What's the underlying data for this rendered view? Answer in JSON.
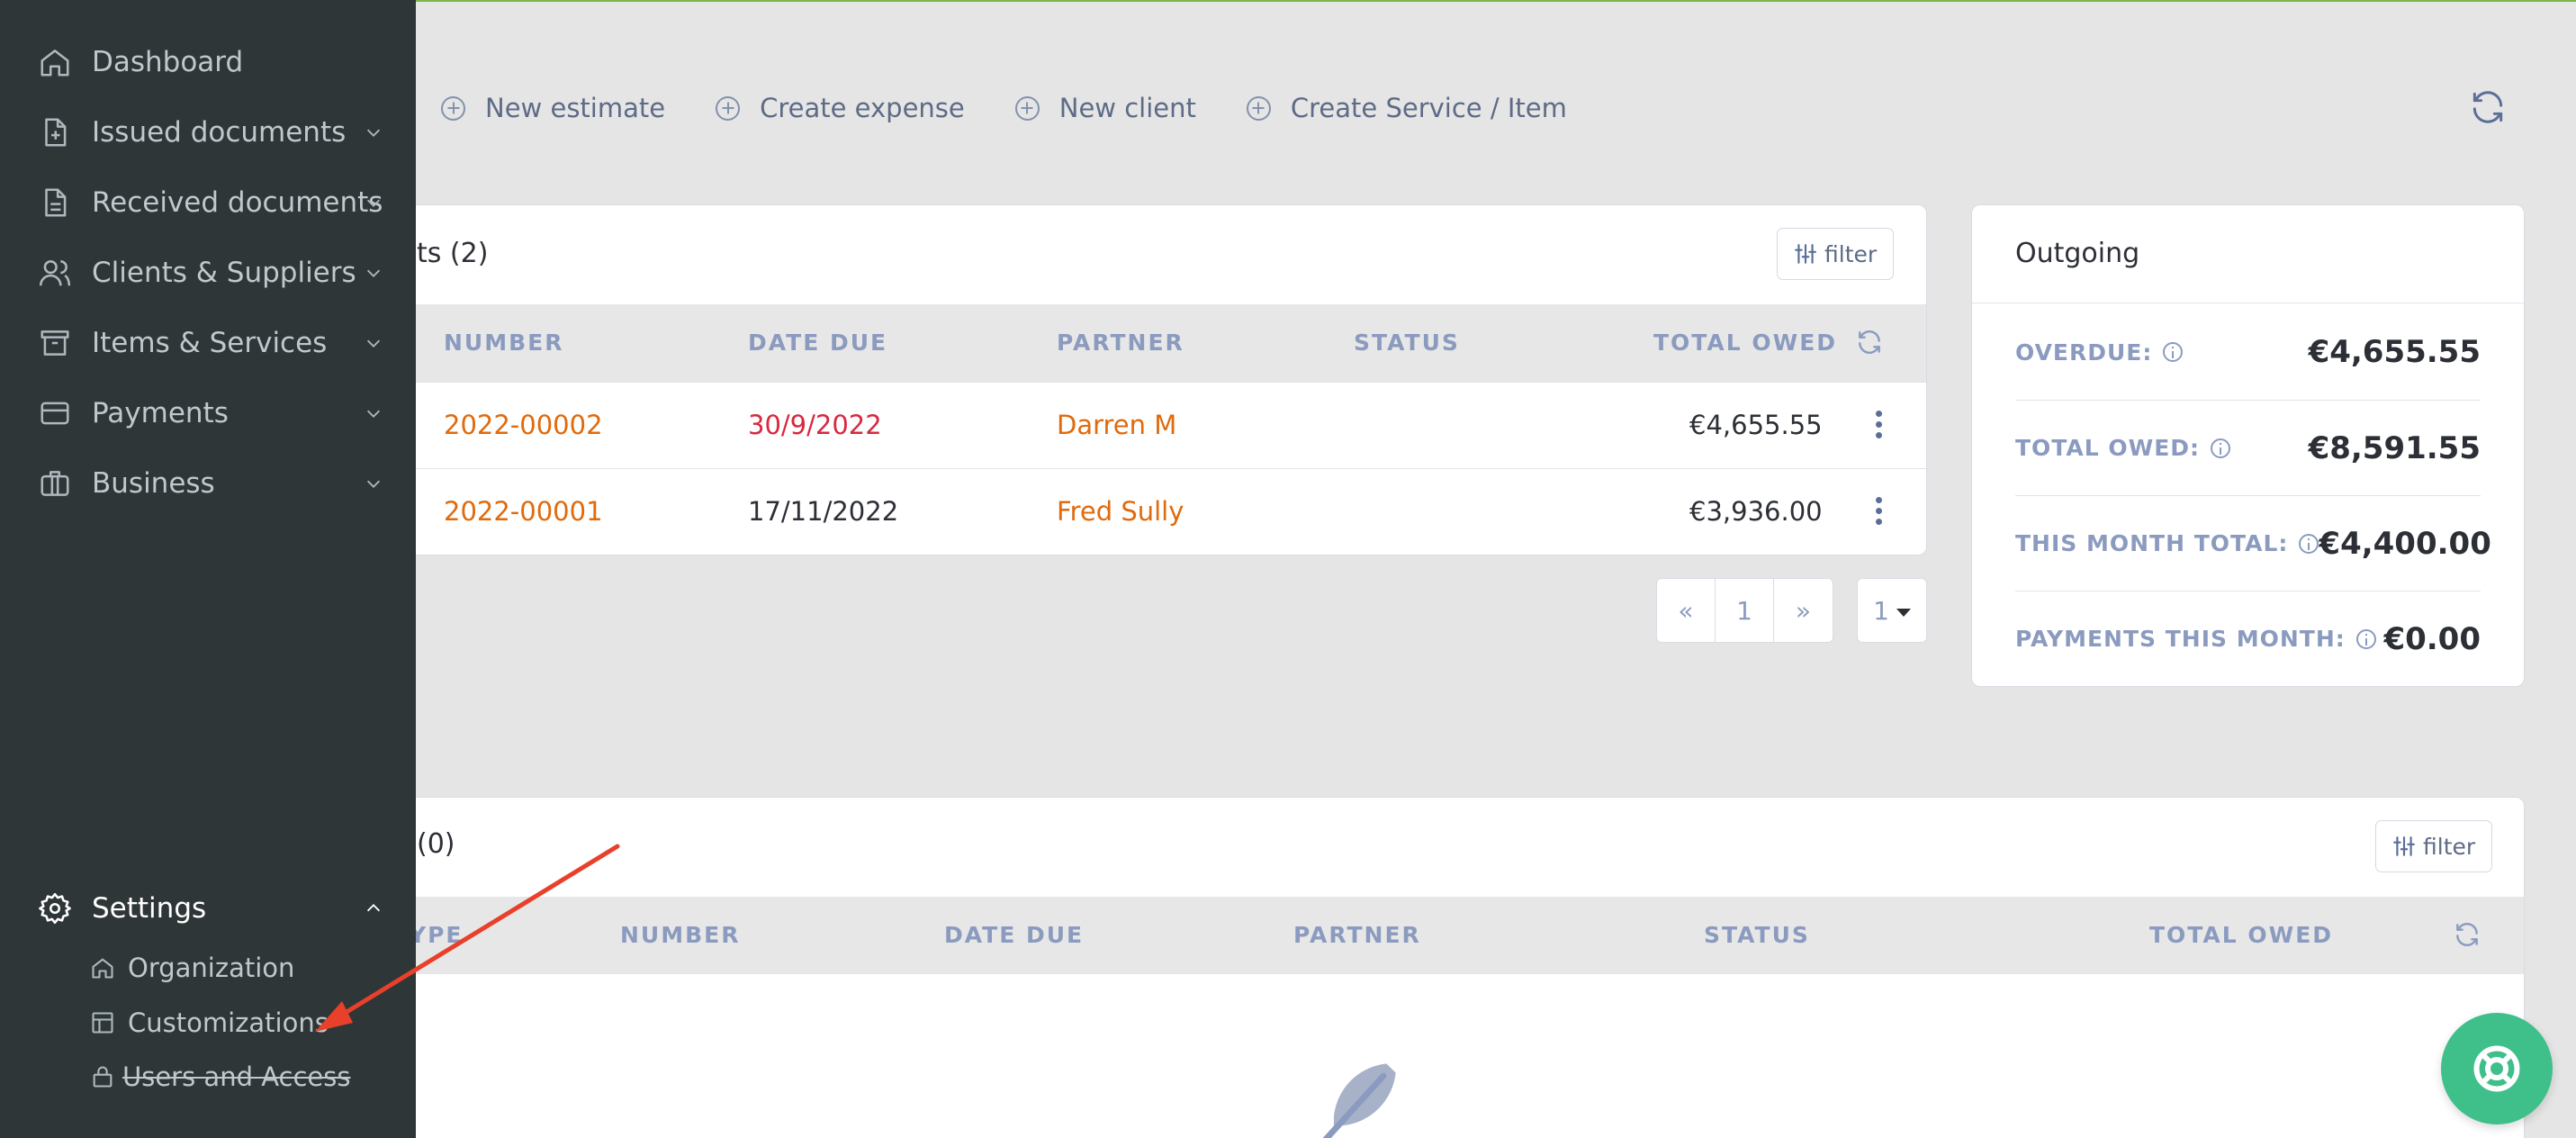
{
  "actions": [
    {
      "label": "New estimate",
      "icon": "plus-circle-icon"
    },
    {
      "label": "Create expense",
      "icon": "plus-circle-icon"
    },
    {
      "label": "New client",
      "icon": "plus-circle-icon"
    },
    {
      "label": "Create Service / Item",
      "icon": "plus-circle-icon"
    }
  ],
  "estimates": {
    "title": "ts (2)",
    "filter_label": "filter",
    "columns": [
      "NUMBER",
      "DATE DUE",
      "PARTNER",
      "STATUS",
      "TOTAL OWED"
    ],
    "rows": [
      {
        "number": "2022-00002",
        "date_due": "30/9/2022",
        "partner": "Darren M",
        "status": "",
        "total": "€4,655.55",
        "overdue": true
      },
      {
        "number": "2022-00001",
        "date_due": "17/11/2022",
        "partner": "Fred Sully",
        "status": "",
        "total": "€3,936.00",
        "overdue": false
      }
    ],
    "pager": {
      "prev": "«",
      "page": "1",
      "next": "»",
      "per_page": "1"
    }
  },
  "outgoing": {
    "title": "Outgoing",
    "stats": [
      {
        "label": "OVERDUE:",
        "value": "€4,655.55"
      },
      {
        "label": "TOTAL OWED:",
        "value": "€8,591.55"
      },
      {
        "label": "THIS MONTH TOTAL:",
        "value": "€4,400.00"
      },
      {
        "label": "PAYMENTS THIS MONTH:",
        "value": "€0.00"
      }
    ]
  },
  "second_table": {
    "title": "(0)",
    "filter_label": "filter",
    "columns": [
      "YPE",
      "NUMBER",
      "DATE DUE",
      "PARTNER",
      "STATUS",
      "TOTAL OWED"
    ]
  },
  "sidebar": {
    "items": [
      {
        "label": "Dashboard",
        "icon": "home-icon",
        "expandable": false
      },
      {
        "label": "Issued documents",
        "icon": "document-plus-icon",
        "expandable": true
      },
      {
        "label": "Received documents",
        "icon": "document-icon",
        "expandable": true
      },
      {
        "label": "Clients & Suppliers",
        "icon": "users-icon",
        "expandable": true
      },
      {
        "label": "Items & Services",
        "icon": "archive-icon",
        "expandable": true
      },
      {
        "label": "Payments",
        "icon": "credit-card-icon",
        "expandable": true
      },
      {
        "label": "Business",
        "icon": "briefcase-icon",
        "expandable": true
      }
    ],
    "settings": {
      "label": "Settings",
      "icon": "gear-icon",
      "sub_items": [
        {
          "label": "Organization",
          "icon": "home-icon"
        },
        {
          "label": "Customizations",
          "icon": "layout-icon"
        },
        {
          "label": "Users and Access",
          "icon": "lock-icon"
        }
      ]
    }
  },
  "colors": {
    "sidebar_bg": "#2f3638",
    "accent_orange": "#e06a0c",
    "overdue_red": "#d9283f",
    "help_green": "#3fbf8a",
    "annotation_arrow": "#e8402a"
  }
}
